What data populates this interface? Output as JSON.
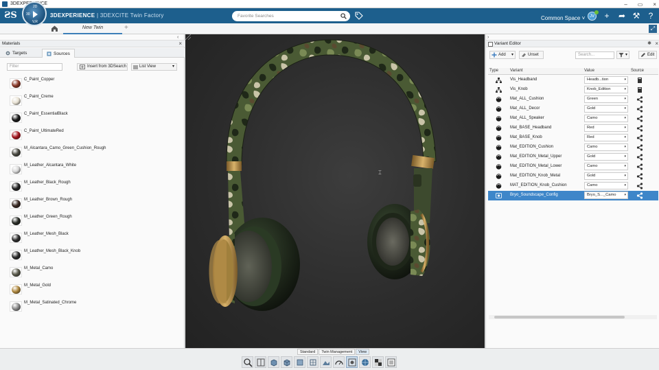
{
  "window": {
    "title": "3DEXPERIENCE",
    "controls": [
      "–",
      "▭",
      "×"
    ]
  },
  "topbar": {
    "brand_bold": "3DEXPERIENCE",
    "brand_rest": "| 3DEXCITE Twin Factory",
    "compass_n": "2D",
    "compass_w": "30",
    "compass_v": "V,R",
    "search_placeholder": "Favorite Searches",
    "space": "Common Space",
    "avatar_initials": "JV"
  },
  "tabs": {
    "active": "New Twin",
    "add": "+"
  },
  "materials": {
    "panel_title": "Materials",
    "tabs": [
      "Targets",
      "Sources"
    ],
    "filter_placeholder": "Filter",
    "insert_label": "Insert from 3DSearch",
    "view_label": "List View",
    "items": [
      {
        "name": "C_Paint_Copper",
        "color": "#8a3a2a"
      },
      {
        "name": "C_Paint_Creme",
        "color": "#e8e2d4"
      },
      {
        "name": "C_Paint_EssentialBlack",
        "color": "#1c1c1c"
      },
      {
        "name": "C_Paint_UltimateRed",
        "color": "#a51a22"
      },
      {
        "name": "M_Alcantara_Camo_Green_Cushion_Rough",
        "color": "#4a4a42"
      },
      {
        "name": "M_Leather_Alcantara_White",
        "color": "#d8d8d8"
      },
      {
        "name": "M_Leather_Black_Rough",
        "color": "#262626"
      },
      {
        "name": "M_Leather_Brown_Rough",
        "color": "#3a2a24"
      },
      {
        "name": "M_Leather_Green_Rough",
        "color": "#2a2d28"
      },
      {
        "name": "M_Leather_Mesh_Black",
        "color": "#303030"
      },
      {
        "name": "M_Leather_Mesh_Black_Knob",
        "color": "#2d2d2d"
      },
      {
        "name": "M_Metal_Camo",
        "color": "#5a5a4c"
      },
      {
        "name": "M_Metal_Gold",
        "color": "#b08a42"
      },
      {
        "name": "M_Metal_Satinated_Chrome",
        "color": "#8c8c8c"
      }
    ]
  },
  "variant_editor": {
    "title": "Variant Editor",
    "add_label": "Add",
    "unset_label": "Unset",
    "search_placeholder": "Search...",
    "edit_label": "Edit",
    "columns": {
      "type": "Type",
      "variant": "Variant",
      "value": "Value",
      "source": "Source"
    },
    "rows": [
      {
        "type": "tree",
        "name": "Vis_Headband",
        "value": "Headb...tion",
        "source": "book",
        "selected": false
      },
      {
        "type": "tree",
        "name": "Vis_Knob",
        "value": "Knob_Edition",
        "source": "book",
        "selected": false
      },
      {
        "type": "material",
        "name": "Mat_ALL_Cushion",
        "value": "Green",
        "source": "share",
        "selected": false
      },
      {
        "type": "material",
        "name": "Mat_ALL_Decor",
        "value": "Gold",
        "source": "share",
        "selected": false
      },
      {
        "type": "material",
        "name": "Mat_ALL_Speaker",
        "value": "Camo",
        "source": "share",
        "selected": false
      },
      {
        "type": "material",
        "name": "Mat_BASE_Headband",
        "value": "Red",
        "source": "share",
        "selected": false
      },
      {
        "type": "material",
        "name": "Mat_BASE_Knob",
        "value": "Red",
        "source": "share",
        "selected": false
      },
      {
        "type": "material",
        "name": "Mat_EDITION_Cushion",
        "value": "Camo",
        "source": "share",
        "selected": false
      },
      {
        "type": "material",
        "name": "Mat_EDITION_Metal_Upper",
        "value": "Gold",
        "source": "share",
        "selected": false
      },
      {
        "type": "material",
        "name": "Mat_EDITION_Metal_Lower",
        "value": "Camo",
        "source": "share",
        "selected": false
      },
      {
        "type": "material",
        "name": "Mat_EDITION_Knob_Metal",
        "value": "Gold",
        "source": "share",
        "selected": false
      },
      {
        "type": "material",
        "name": "MAT_EDITION_Knob_Cushion",
        "value": "Camo",
        "source": "share",
        "selected": false
      },
      {
        "type": "config",
        "name": "Bryo_Soundscape_Config",
        "value": "Bryo_S..._Camo",
        "source": "share",
        "selected": true
      }
    ]
  },
  "bottom": {
    "tabs": [
      "Standard",
      "Twin Management",
      "View"
    ],
    "active_tab": "View",
    "tools": [
      "zoom-icon",
      "book-icon",
      "cube-front-icon",
      "cube-iso-icon",
      "cube-side-icon",
      "cube-grid-icon",
      "scene-icon",
      "speedometer-icon",
      "render-icon",
      "sphere-icon",
      "checker-icon",
      "list-icon"
    ],
    "active_tool": 8
  },
  "colors": {
    "brand_blue": "#1d5f8d",
    "select_blue": "#3e86c9",
    "camo_dark": "#2f3a22",
    "gold": "#b58f48"
  }
}
